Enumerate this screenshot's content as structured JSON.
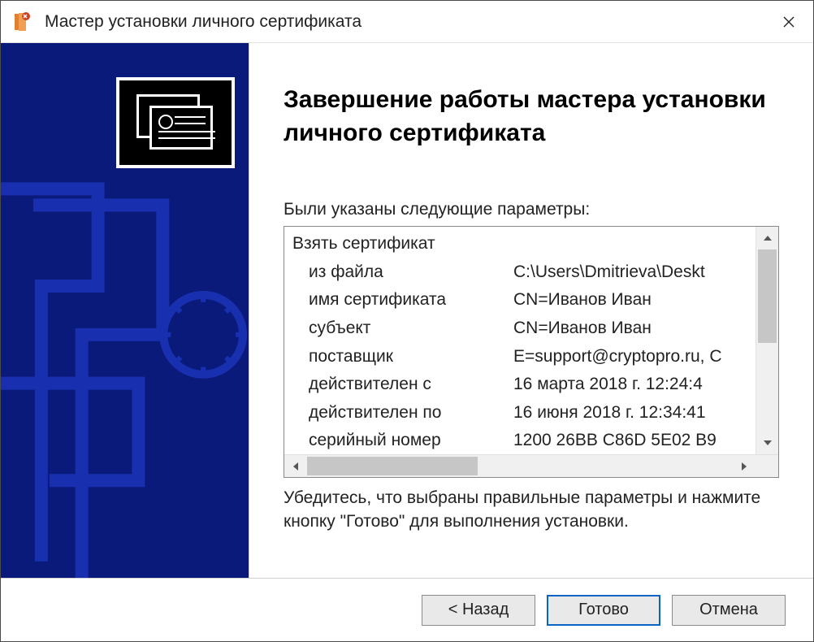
{
  "window": {
    "title": "Мастер установки личного сертификата"
  },
  "main": {
    "heading": "Завершение работы мастера установки личного сертификата",
    "params_label": "Были указаны следующие параметры:",
    "section_header": "Взять сертификат",
    "rows": [
      {
        "label": "из файла",
        "value": "C:\\Users\\Dmitrieva\\Deskt"
      },
      {
        "label": "имя сертификата",
        "value": "CN=Иванов Иван"
      },
      {
        "label": "субъект",
        "value": "CN=Иванов Иван"
      },
      {
        "label": "поставщик",
        "value": "E=support@cryptopro.ru, C"
      },
      {
        "label": "действителен с",
        "value": "16 марта 2018 г. 12:24:4"
      },
      {
        "label": "действителен по",
        "value": "16 июня 2018 г. 12:34:41"
      },
      {
        "label": "серийный номер",
        "value": "1200 26BB C86D 5E02 B9"
      }
    ],
    "bottom_text": "Убедитесь, что выбраны правильные параметры и нажмите кнопку \"Готово\" для выполнения установки."
  },
  "footer": {
    "back": "< Назад",
    "finish": "Готово",
    "cancel": "Отмена"
  }
}
